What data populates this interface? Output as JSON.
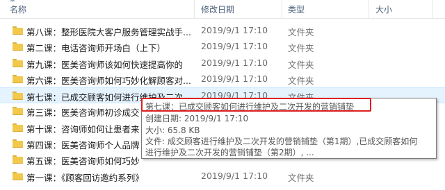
{
  "columns": {
    "name": "名称",
    "modified": "修改日期",
    "type": "类型",
    "size": "大小"
  },
  "rows": [
    {
      "name": "第八课：整形医院大客户服务管理实战手...",
      "date": "2019/9/1 17:10",
      "type": "文件夹"
    },
    {
      "name": "第二课：电话咨询师开场白（上下）",
      "date": "2019/9/1 17:10",
      "type": "文件夹"
    },
    {
      "name": "第九课：医美咨询师该如何快速提高你的",
      "date": "2019/9/1 17:10",
      "type": "文件夹"
    },
    {
      "name": "第六课：医美咨询师如何巧妙化解顾客对...",
      "date": "2019/9/1 17:10",
      "type": "文件夹"
    },
    {
      "name": "第七课：已成交顾客如何进行维护及二次...",
      "date": "2019/9/1 17:10",
      "type": "文件夹"
    },
    {
      "name": "第三课：医美咨询师初诊成交",
      "date": "",
      "type": ""
    },
    {
      "name": "第十课：咨询师如何让患者来",
      "date": "",
      "type": ""
    },
    {
      "name": "第四课：医美咨询师个人品牌",
      "date": "",
      "type": ""
    },
    {
      "name": "第五课：医美咨询师如何巧妙",
      "date": "",
      "type": ""
    },
    {
      "name": "第一课：《顾客回访邀约系列》",
      "date": "2019/9/1 17:10",
      "type": "文件夹"
    }
  ],
  "tooltip": {
    "title": "第七课：已成交顾客如何进行维护及二次开发的营销铺垫",
    "created": "创建日期: 2019/9/1 17:10",
    "size": "大小: 65.8 KB",
    "files_line1": "文件: 成交顾客进行维护及二次开发的营销铺垫（第1期）,已成交顾客如何",
    "files_line2": "进行维护及二次开发的营销铺垫（第2期）, ..."
  }
}
